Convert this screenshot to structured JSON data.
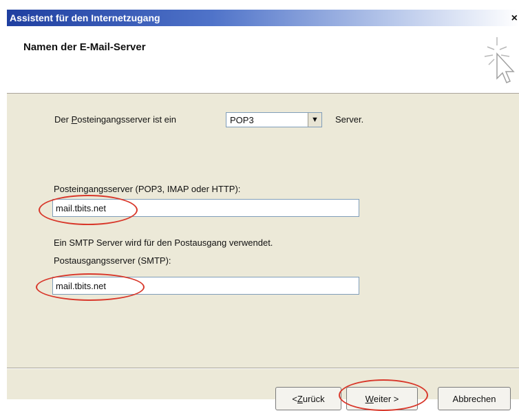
{
  "window": {
    "title": "Assistent für den Internetzugang",
    "close_glyph": "×"
  },
  "header": {
    "title": "Namen der E-Mail-Server",
    "icon": "wizard-cursor-icon"
  },
  "server_type": {
    "prefix_pre": "Der ",
    "prefix_mnemonic": "P",
    "prefix_post": "osteingangsserver ist ein",
    "selected": "POP3",
    "suffix": "Server."
  },
  "incoming": {
    "label": "Posteingangsserver (POP3, IMAP oder HTTP):",
    "value": "mail.tbits.net"
  },
  "smtp_info": "Ein SMTP Server wird für den Postausgang verwendet.",
  "outgoing": {
    "label": "Postausgangsserver (SMTP):",
    "value": "mail.tbits.net"
  },
  "buttons": {
    "back_pre": "< ",
    "back_mnemonic": "Z",
    "back_post": "urück",
    "next_mnemonic": "W",
    "next_post": "eiter >",
    "cancel": "Abbrechen"
  },
  "colors": {
    "highlight_circle": "#d8372a",
    "titlebar": "#1f3fa0",
    "panel": "#ece9d8"
  }
}
